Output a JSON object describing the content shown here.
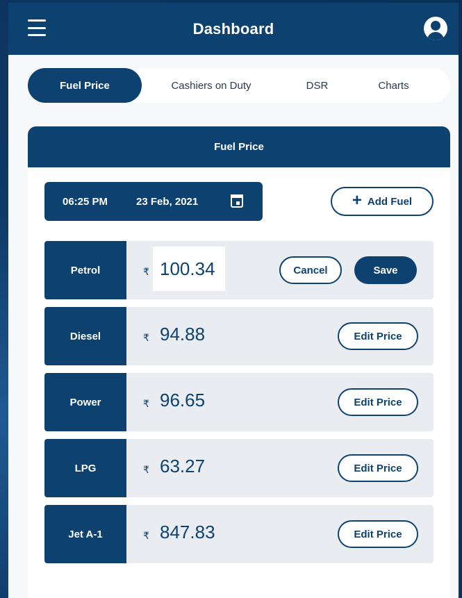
{
  "header": {
    "title": "Dashboard"
  },
  "tabs": [
    {
      "label": "Fuel Price",
      "active": true
    },
    {
      "label": "Cashiers on Duty",
      "active": false
    },
    {
      "label": "DSR",
      "active": false
    },
    {
      "label": "Charts",
      "active": false
    }
  ],
  "card": {
    "title": "Fuel Price"
  },
  "datetime": {
    "time": "06:25 PM",
    "date": "23 Feb, 2021"
  },
  "add_fuel_label": "Add Fuel",
  "currency_symbol": "₹",
  "fuels": [
    {
      "name": "Petrol",
      "price": "100.34",
      "editing": true
    },
    {
      "name": "Diesel",
      "price": "94.88",
      "editing": false
    },
    {
      "name": "Power",
      "price": "96.65",
      "editing": false
    },
    {
      "name": "LPG",
      "price": "63.27",
      "editing": false
    },
    {
      "name": "Jet A-1",
      "price": "847.83",
      "editing": false
    }
  ],
  "buttons": {
    "cancel": "Cancel",
    "save": "Save",
    "edit_price": "Edit Price"
  },
  "colors": {
    "primary": "#0d4170",
    "row_bg": "#e9edf2",
    "page_bg": "#f7f8fa"
  }
}
